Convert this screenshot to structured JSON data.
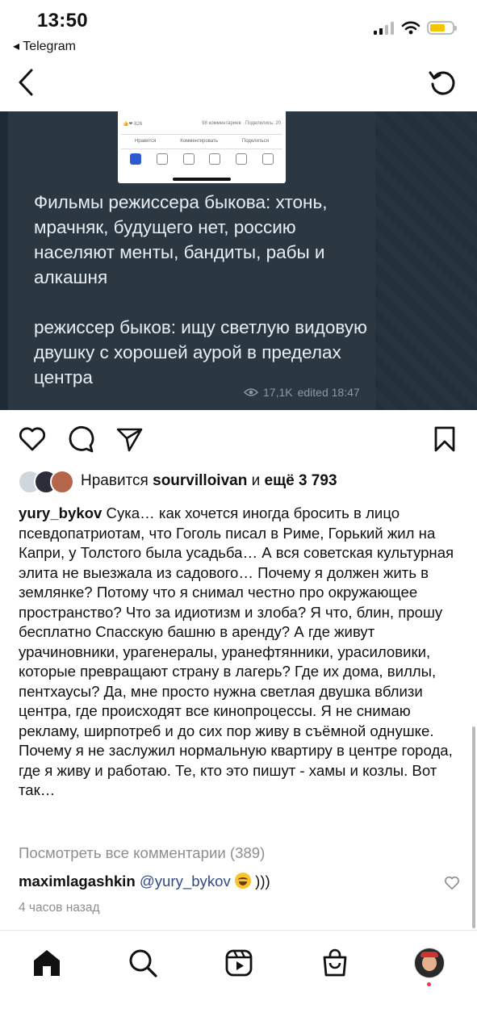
{
  "status_bar": {
    "time": "13:50",
    "back_app": "◂ Telegram"
  },
  "post_image": {
    "screenshot_row1_left": "👍❤ 826",
    "screenshot_row1_right": "98 комментариев · Поделились: 20",
    "screenshot_actions": [
      "Нравится",
      "Комментировать",
      "Поделиться"
    ],
    "message_para1": "Фильмы режиссера быкова: хтонь, мрачняк, будущего нет, россию населяют менты, бандиты, рабы и алкашня",
    "message_para2": "режиссер быков: ищу светлую видовую двушку с хорошей аурой в пределах центра",
    "views": "17,1K",
    "edited": "edited 18:47"
  },
  "likes": {
    "prefix": "Нравится",
    "user": "sourvilloivan",
    "joiner": "и",
    "more": "ещё 3 793"
  },
  "caption": {
    "user": "yury_bykov",
    "text": "Сука… как хочется иногда бросить в лицо псевдопатриотам, что Гоголь писал в Риме, Горький жил на Капри, у Толстого была усадьба… А вся советская культурная элита не выезжала из садового… Почему я должен жить в землянке? Потому что я снимал честно про окружающее пространство? Что за идиотизм и злоба? Я что, блин, прошу бесплатно Спасскую башню в аренду? А где живут урачиновники, урагенералы, уранефтянники, урасиловики, которые превращают страну в лагерь? Где их дома, виллы, пентхаусы? Да, мне просто нужна светлая двушка вблизи центра, где происходят все кинопроцессы. Я не снимаю рекламу, ширпотреб и до сих пор живу в съёмной однушке. Почему я не заслужил нормальную квартиру в центре города, где я живу и работаю. Те, кто это пишут - хамы и козлы. Вот так…"
  },
  "view_all": "Посмотреть все комментарии (389)",
  "comment": {
    "user": "maximlagashkin",
    "mention": "@yury_bykov",
    "suffix": ")))"
  },
  "time_ago": "4 часов назад",
  "icons": {
    "back": "chevron-left-icon",
    "refresh": "refresh-icon",
    "like": "heart-icon",
    "comment": "comment-icon",
    "share": "send-icon",
    "save": "bookmark-icon",
    "home": "home-icon",
    "search": "search-icon",
    "reels": "reels-icon",
    "shop": "shop-icon"
  },
  "colors": {
    "battery": "#f5c400",
    "mention": "#2f4a8a",
    "notification": "#ff3040"
  }
}
